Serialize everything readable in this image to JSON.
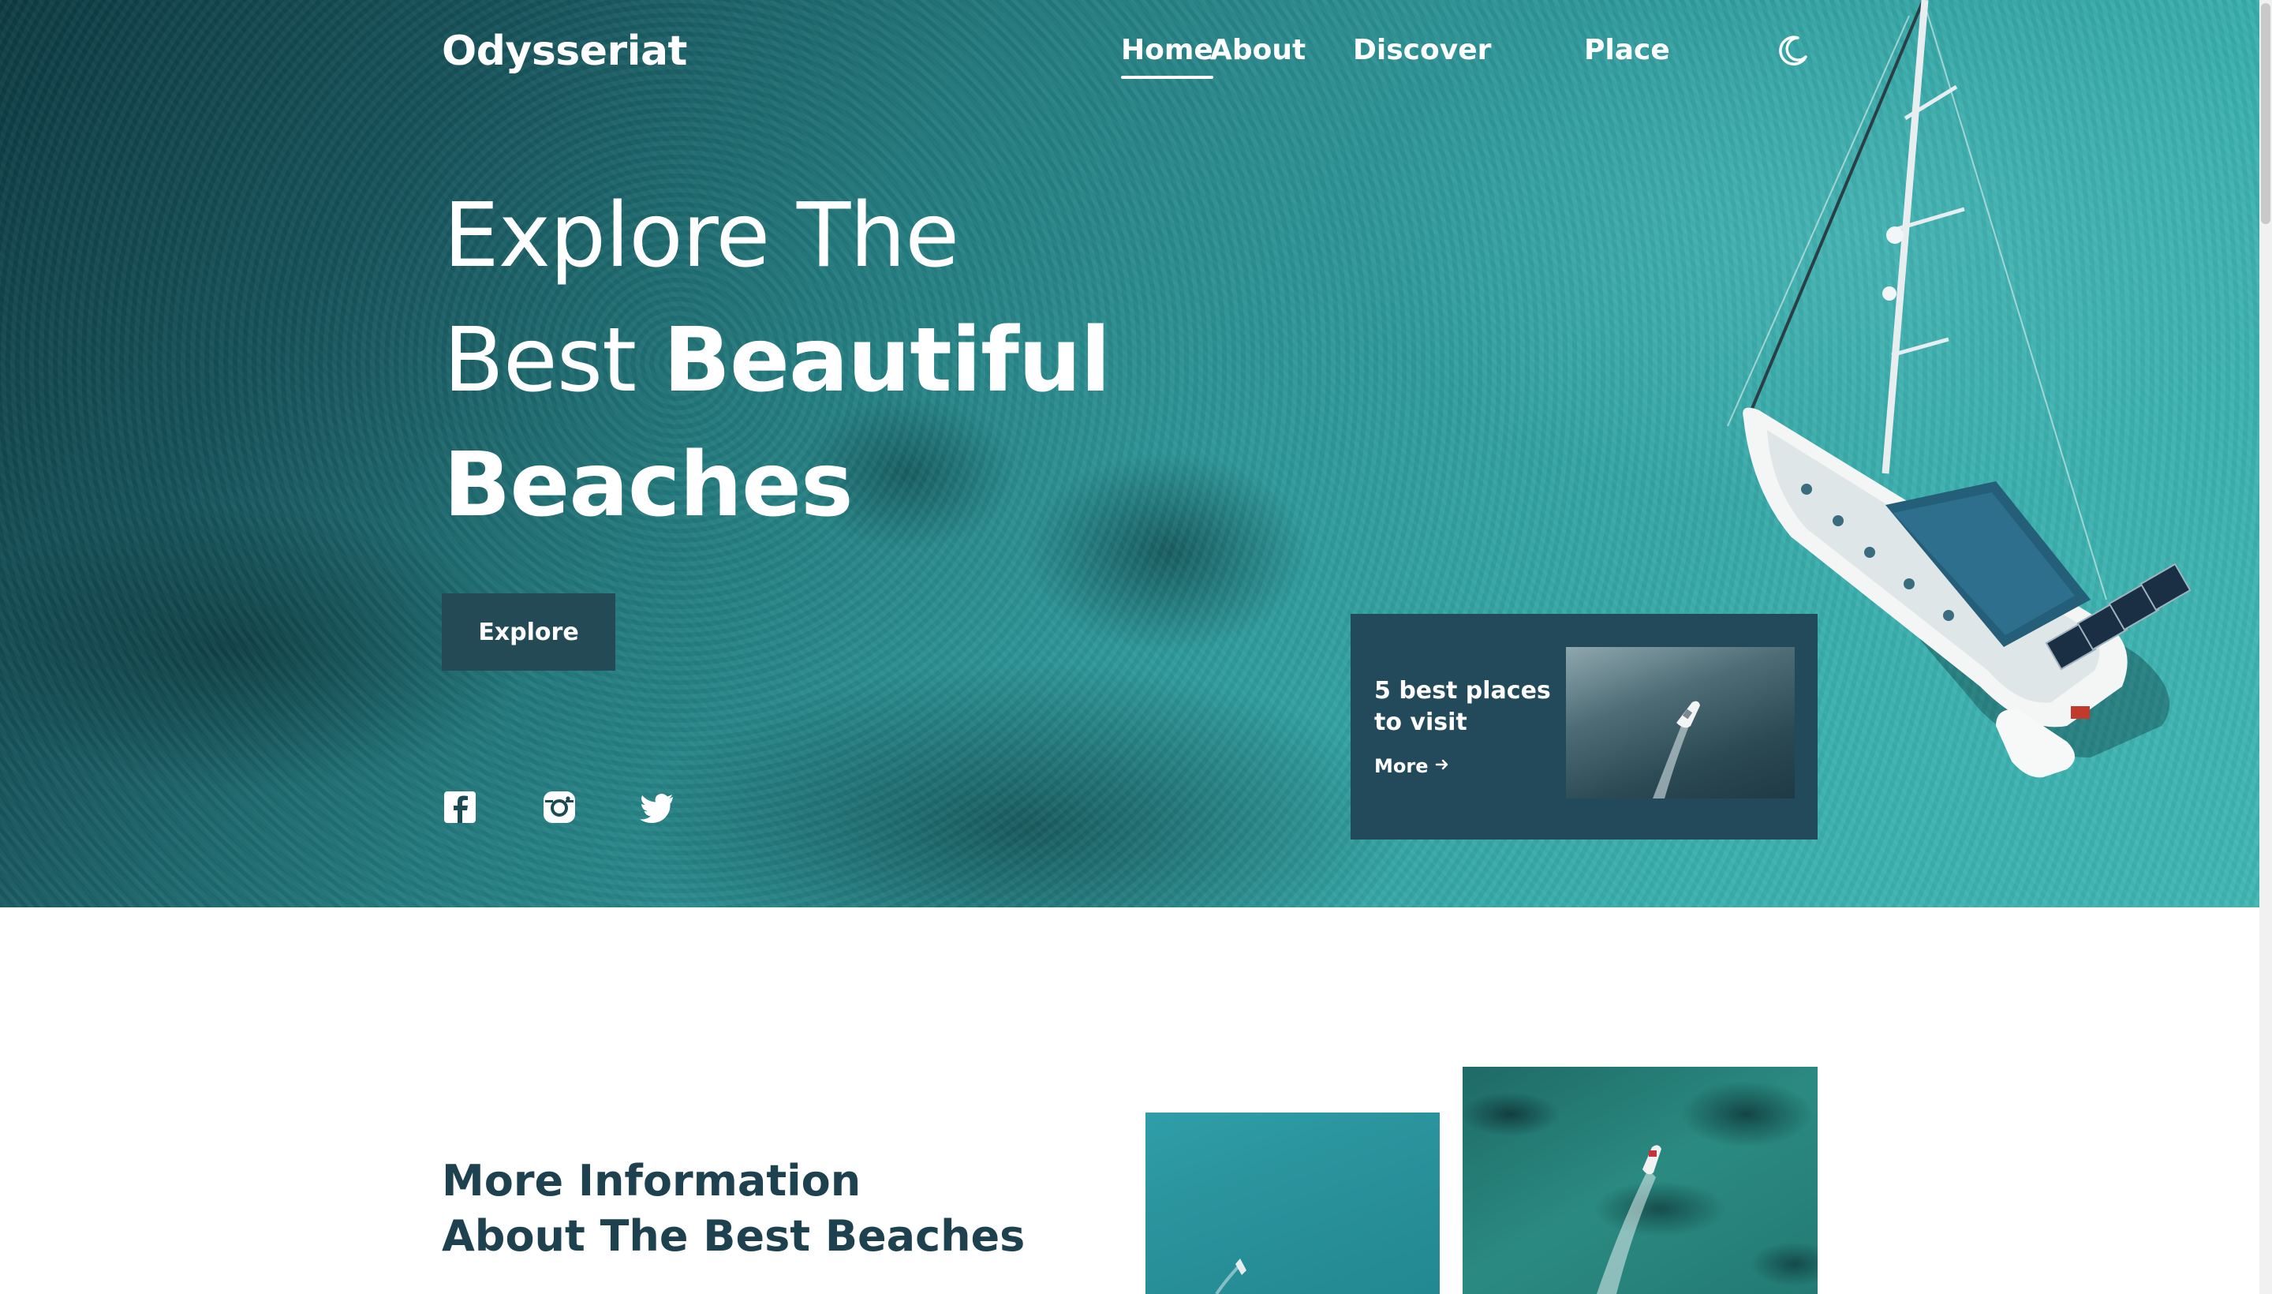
{
  "brand": {
    "logo_text": "Odysseriat"
  },
  "nav": {
    "items": [
      {
        "label": "Home",
        "active": true
      },
      {
        "label": "About",
        "active": false
      },
      {
        "label": "Discover",
        "active": false
      },
      {
        "label": "Place",
        "active": false
      }
    ],
    "theme_toggle_icon": "moon-icon"
  },
  "hero": {
    "title_line1": "Explore The",
    "title_line2_light": "Best ",
    "title_line2_bold": "Beautiful",
    "title_line3": "Beaches",
    "cta_label": "Explore",
    "social_icons": [
      "facebook-icon",
      "instagram-icon",
      "twitter-icon"
    ]
  },
  "promo": {
    "title": "5 best places to visit",
    "more_label": "More",
    "more_icon": "arrow-right-icon"
  },
  "info": {
    "title_line1": "More Information",
    "title_line2": "About The Best Beaches"
  },
  "colors": {
    "accent_dark": "#234a55",
    "card_bg": "#234a5a",
    "heading_dark": "#1e4150",
    "sea_light": "#40b7b4",
    "sea_dark": "#0d3a42"
  }
}
